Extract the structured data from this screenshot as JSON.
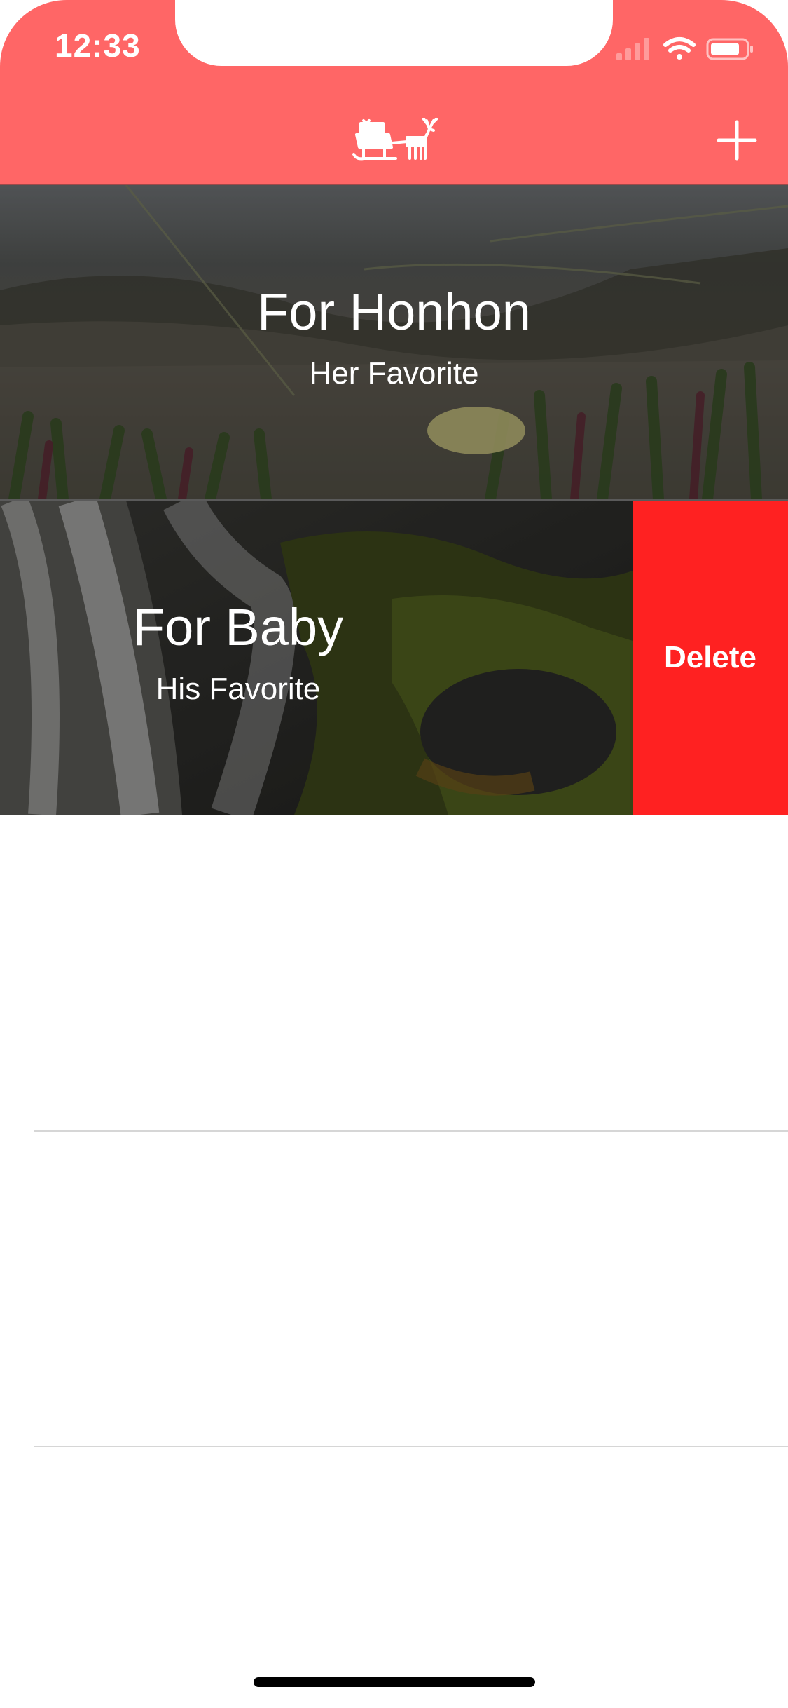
{
  "status_bar": {
    "time": "12:33",
    "icons": [
      "cellular-signal-icon",
      "wifi-icon",
      "battery-icon"
    ]
  },
  "nav_bar": {
    "logo_icon": "sleigh-reindeer-icon",
    "add_icon": "plus-icon",
    "color": "#ff6666"
  },
  "list": {
    "items": [
      {
        "title": "For Honhon",
        "subtitle": "Her Favorite",
        "image": "beach-dune-flower"
      },
      {
        "title": "For Baby",
        "subtitle": "His Favorite",
        "image": "waterfall-mossy-rock",
        "swipe_action": "Delete"
      }
    ]
  },
  "colors": {
    "delete": "#ff2121",
    "accent": "#ff6666"
  }
}
